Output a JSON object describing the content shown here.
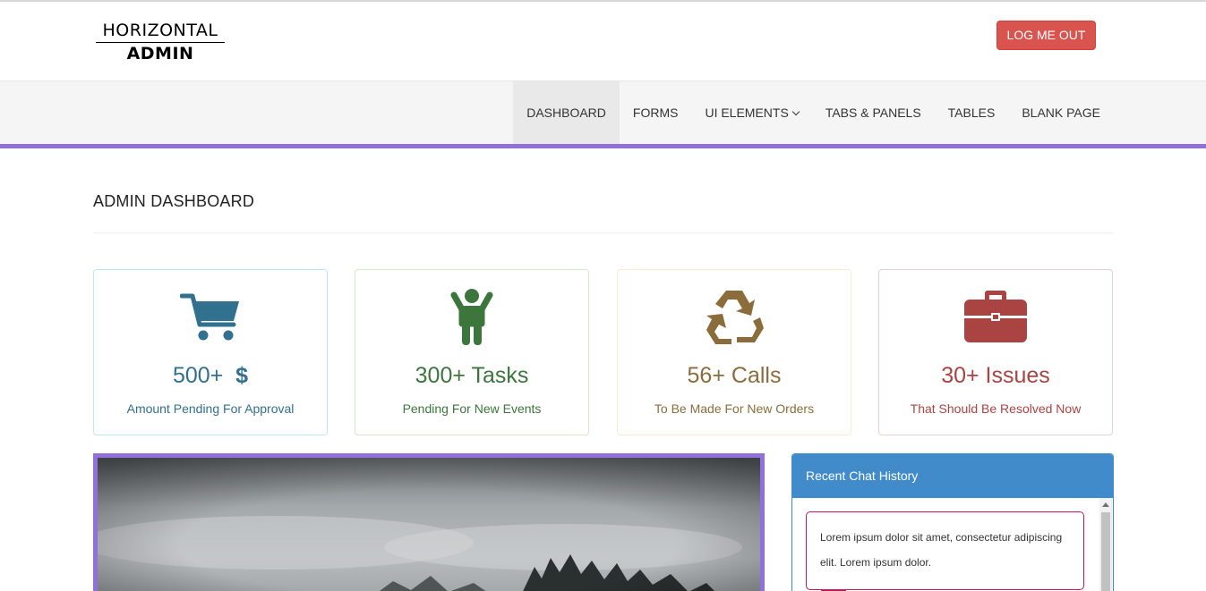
{
  "header": {
    "logo_line1": "HORIZONTAL",
    "logo_line2": "ADMIN",
    "logout_label": "LOG ME OUT"
  },
  "nav": {
    "items": [
      {
        "label": "DASHBOARD",
        "active": true
      },
      {
        "label": "FORMS"
      },
      {
        "label": "UI ELEMENTS",
        "icon": "chevron-down-icon"
      },
      {
        "label": "TABS & PANELS"
      },
      {
        "label": "TABLES"
      },
      {
        "label": "BLANK PAGE"
      }
    ],
    "accent_color": "#9170d8"
  },
  "page": {
    "title": "ADMIN DASHBOARD"
  },
  "cards": [
    {
      "icon": "shopping-cart-icon",
      "value": "500+",
      "value_icon": "dollar-icon",
      "value_symbol": "$",
      "caption": "Amount Pending For Approval",
      "color": "#31708f",
      "border": "#bce8f1"
    },
    {
      "icon": "person-icon",
      "value": "300+ Tasks",
      "caption": "Pending For New Events",
      "color": "#3c763d",
      "border": "#d6e9c6"
    },
    {
      "icon": "recycle-icon",
      "value": "56+ Calls",
      "caption": "To Be Made For New Orders",
      "color": "#8a6d3b",
      "border": "#faebcc"
    },
    {
      "icon": "briefcase-icon",
      "value": "30+ Issues",
      "caption": "That Should Be Resolved Now",
      "color": "#a94442",
      "border": "#ebccd1"
    }
  ],
  "chat": {
    "title": "Recent Chat History",
    "messages": [
      {
        "text": "Lorem ipsum dolor sit amet, consectetur adipiscing elit. Lorem ipsum dolor."
      }
    ],
    "header_color": "#428bca"
  }
}
